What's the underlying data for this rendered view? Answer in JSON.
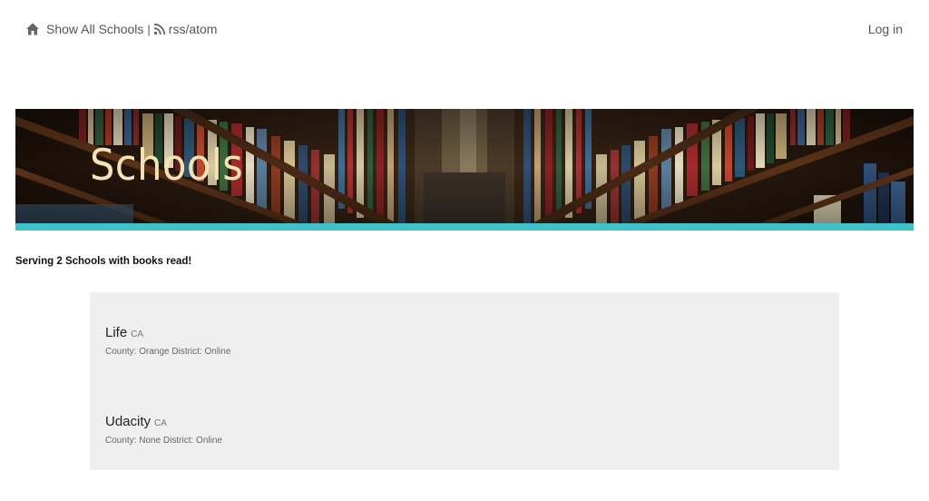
{
  "nav": {
    "home_label": "Show All Schools",
    "separator": "|",
    "rss_label": "rss/atom",
    "login_label": "Log in"
  },
  "banner": {
    "title": "Schools",
    "accent_color": "#3fc1c9"
  },
  "summary": "Serving 2 Schools with books read!",
  "schools": [
    {
      "name": "Life",
      "state": "CA",
      "meta": "County: Orange District: Online"
    },
    {
      "name": "Udacity",
      "state": "CA",
      "meta": "County: None District: Online"
    }
  ],
  "icons": {
    "home": "home-icon",
    "rss": "rss-icon"
  }
}
